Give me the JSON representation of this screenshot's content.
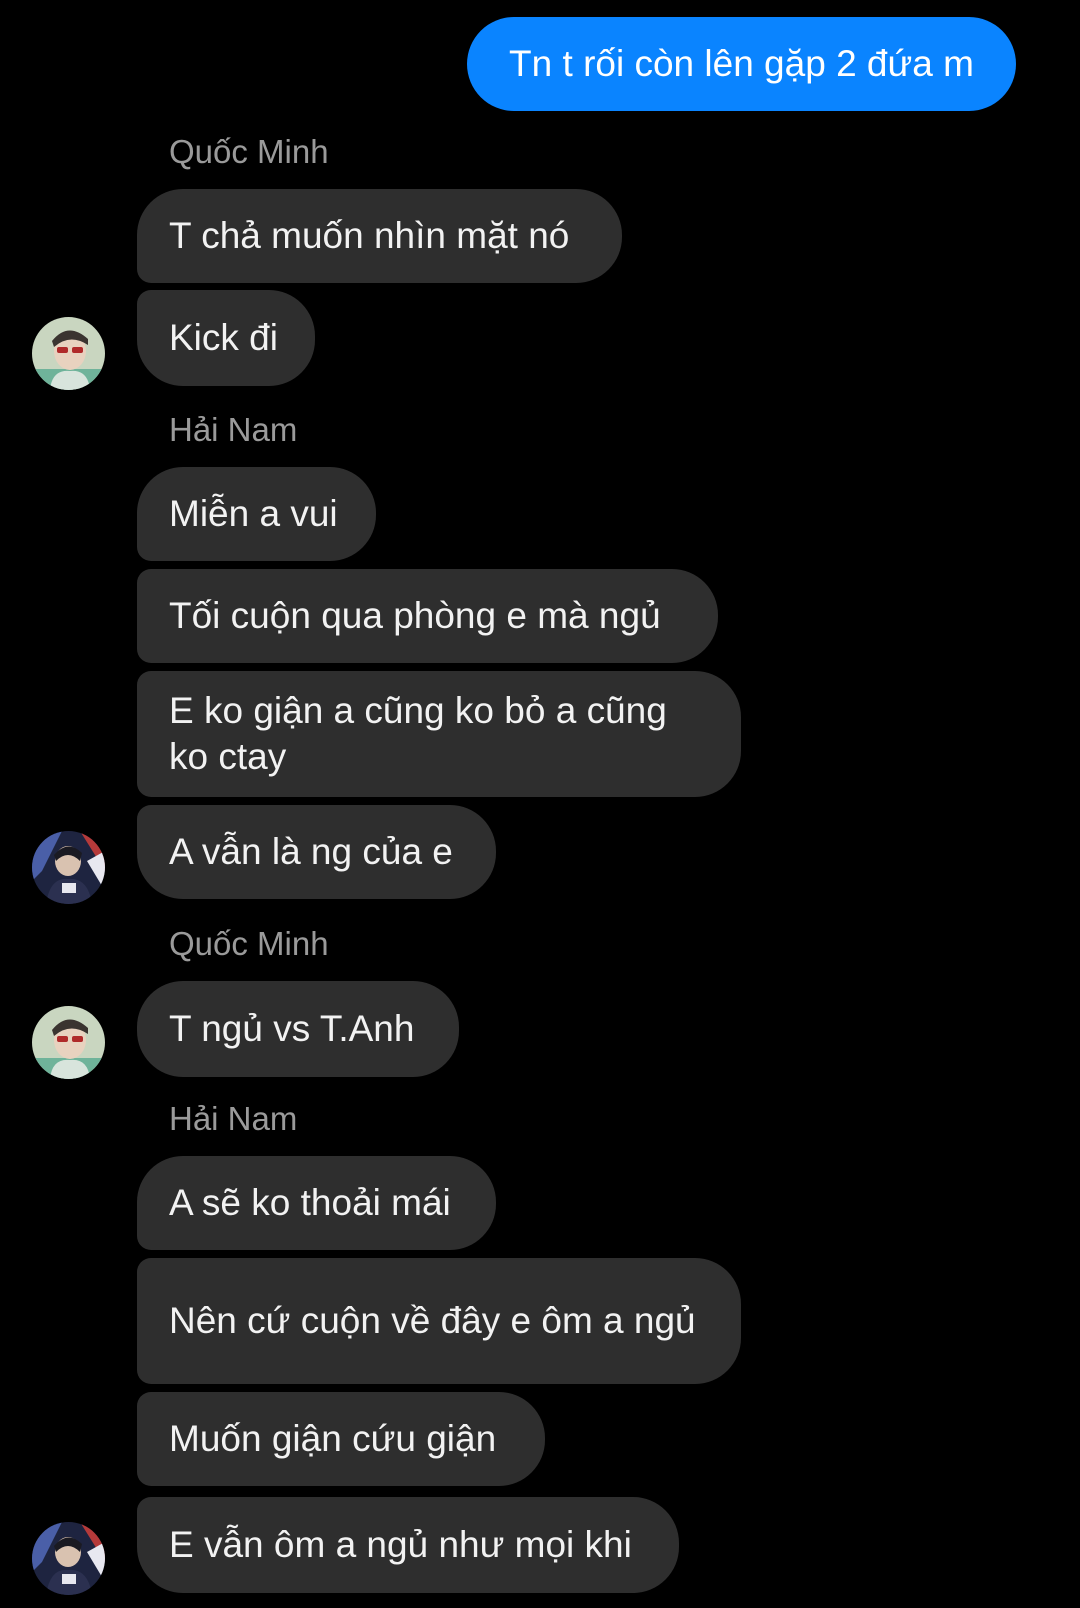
{
  "colors": {
    "background": "#000000",
    "outgoing_bubble": "#0a84ff",
    "incoming_bubble": "#2e2e2e",
    "sender_name": "#9a9a9a"
  },
  "messages": {
    "outgoing_1": "Tn t rối còn lên gặp 2 đứa m",
    "group_1": {
      "sender": "Quốc Minh",
      "msg_1": "T chả muốn nhìn mặt nó",
      "msg_2": "Kick đi"
    },
    "group_2": {
      "sender": "Hải Nam",
      "msg_1": "Miễn a vui",
      "msg_2": "Tối cuộn qua phòng e mà ngủ",
      "msg_3": "E ko giận a cũng ko bỏ a cũng ko ctay",
      "msg_4": "A vẫn là ng của e"
    },
    "group_3": {
      "sender": "Quốc Minh",
      "msg_1": "T ngủ vs T.Anh"
    },
    "group_4": {
      "sender": "Hải Nam",
      "msg_1": "A sẽ ko thoải mái",
      "msg_2": "Nên cứ cuộn về đây e ôm a ngủ",
      "msg_3": "Muốn giận cứu giận",
      "msg_4": "E vẫn ôm a ngủ như mọi khi"
    }
  },
  "avatars": {
    "quoc_minh": "avatar-quoc-minh",
    "hai_nam": "avatar-hai-nam"
  }
}
